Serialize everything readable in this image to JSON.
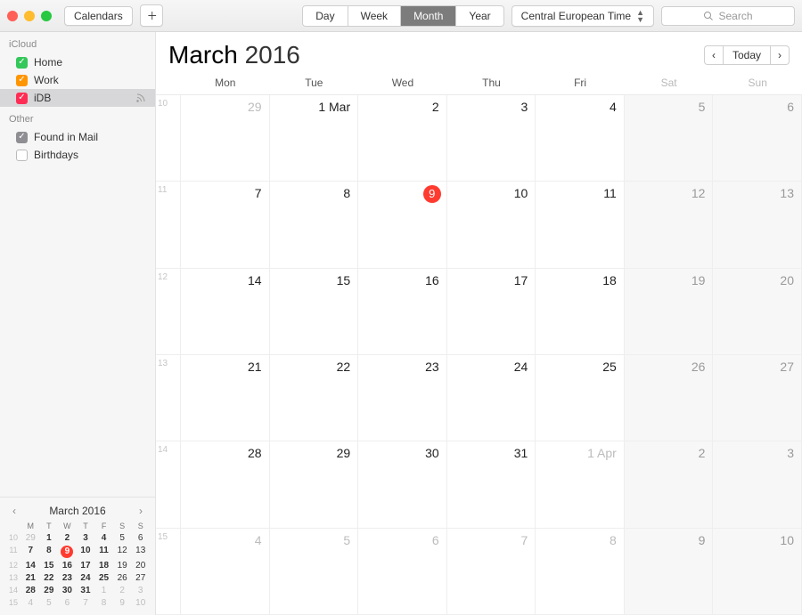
{
  "toolbar": {
    "calendars_label": "Calendars",
    "views": [
      "Day",
      "Week",
      "Month",
      "Year"
    ],
    "active_view_index": 2,
    "timezone_label": "Central European Time",
    "search_placeholder": "Search"
  },
  "sidebar": {
    "sections": [
      {
        "title": "iCloud",
        "items": [
          {
            "label": "Home",
            "checked": true,
            "color": "#34c759",
            "selected": false
          },
          {
            "label": "Work",
            "checked": true,
            "color": "#ff9500",
            "selected": false
          },
          {
            "label": "iDB",
            "checked": true,
            "color": "#ff2d55",
            "selected": true,
            "shared": true
          }
        ]
      },
      {
        "title": "Other",
        "items": [
          {
            "label": "Found in Mail",
            "checked": true,
            "color": "#8e8e93",
            "selected": false
          },
          {
            "label": "Birthdays",
            "checked": false,
            "color": "",
            "selected": false
          }
        ]
      }
    ]
  },
  "mini_calendar": {
    "title": "March 2016",
    "day_headers": [
      "M",
      "T",
      "W",
      "T",
      "F",
      "S",
      "S"
    ],
    "weeks": [
      {
        "wk": 10,
        "days": [
          {
            "n": 29,
            "muted": true
          },
          {
            "n": 1,
            "bold": true
          },
          {
            "n": 2,
            "bold": true
          },
          {
            "n": 3,
            "bold": true
          },
          {
            "n": 4,
            "bold": true
          },
          {
            "n": 5
          },
          {
            "n": 6
          }
        ]
      },
      {
        "wk": 11,
        "days": [
          {
            "n": 7,
            "bold": true
          },
          {
            "n": 8,
            "bold": true
          },
          {
            "n": 9,
            "bold": true,
            "today": true
          },
          {
            "n": 10,
            "bold": true
          },
          {
            "n": 11,
            "bold": true
          },
          {
            "n": 12
          },
          {
            "n": 13
          }
        ]
      },
      {
        "wk": 12,
        "days": [
          {
            "n": 14,
            "bold": true
          },
          {
            "n": 15,
            "bold": true
          },
          {
            "n": 16,
            "bold": true
          },
          {
            "n": 17,
            "bold": true
          },
          {
            "n": 18,
            "bold": true
          },
          {
            "n": 19
          },
          {
            "n": 20
          }
        ]
      },
      {
        "wk": 13,
        "days": [
          {
            "n": 21,
            "bold": true
          },
          {
            "n": 22,
            "bold": true
          },
          {
            "n": 23,
            "bold": true
          },
          {
            "n": 24,
            "bold": true
          },
          {
            "n": 25,
            "bold": true
          },
          {
            "n": 26
          },
          {
            "n": 27
          }
        ]
      },
      {
        "wk": 14,
        "days": [
          {
            "n": 28,
            "bold": true
          },
          {
            "n": 29,
            "bold": true
          },
          {
            "n": 30,
            "bold": true
          },
          {
            "n": 31,
            "bold": true
          },
          {
            "n": 1,
            "muted": true
          },
          {
            "n": 2,
            "muted": true
          },
          {
            "n": 3,
            "muted": true
          }
        ]
      },
      {
        "wk": 15,
        "days": [
          {
            "n": 4,
            "muted": true
          },
          {
            "n": 5,
            "muted": true
          },
          {
            "n": 6,
            "muted": true
          },
          {
            "n": 7,
            "muted": true
          },
          {
            "n": 8,
            "muted": true
          },
          {
            "n": 9,
            "muted": true
          },
          {
            "n": 10,
            "muted": true
          }
        ]
      }
    ]
  },
  "main": {
    "month": "March",
    "year": "2016",
    "today_label": "Today",
    "day_headers": [
      "Mon",
      "Tue",
      "Wed",
      "Thu",
      "Fri",
      "Sat",
      "Sun"
    ],
    "weekend_cols": [
      5,
      6
    ],
    "rows": [
      {
        "wk": "10",
        "cells": [
          {
            "label": "29",
            "muted": true
          },
          {
            "label": "1 Mar"
          },
          {
            "label": "2"
          },
          {
            "label": "3"
          },
          {
            "label": "4"
          },
          {
            "label": "5"
          },
          {
            "label": "6"
          }
        ]
      },
      {
        "wk": "11",
        "cells": [
          {
            "label": "7"
          },
          {
            "label": "8"
          },
          {
            "label": "9",
            "today": true
          },
          {
            "label": "10"
          },
          {
            "label": "11"
          },
          {
            "label": "12"
          },
          {
            "label": "13"
          }
        ]
      },
      {
        "wk": "12",
        "cells": [
          {
            "label": "14"
          },
          {
            "label": "15"
          },
          {
            "label": "16"
          },
          {
            "label": "17"
          },
          {
            "label": "18"
          },
          {
            "label": "19"
          },
          {
            "label": "20"
          }
        ]
      },
      {
        "wk": "13",
        "cells": [
          {
            "label": "21"
          },
          {
            "label": "22"
          },
          {
            "label": "23"
          },
          {
            "label": "24"
          },
          {
            "label": "25"
          },
          {
            "label": "26"
          },
          {
            "label": "27"
          }
        ]
      },
      {
        "wk": "14",
        "cells": [
          {
            "label": "28"
          },
          {
            "label": "29"
          },
          {
            "label": "30"
          },
          {
            "label": "31"
          },
          {
            "label": "1 Apr",
            "muted": true
          },
          {
            "label": "2",
            "muted": true
          },
          {
            "label": "3",
            "muted": true
          }
        ]
      },
      {
        "wk": "15",
        "cells": [
          {
            "label": "4",
            "muted": true
          },
          {
            "label": "5",
            "muted": true
          },
          {
            "label": "6",
            "muted": true
          },
          {
            "label": "7",
            "muted": true
          },
          {
            "label": "8",
            "muted": true
          },
          {
            "label": "9",
            "muted": true
          },
          {
            "label": "10",
            "muted": true
          }
        ]
      }
    ]
  }
}
